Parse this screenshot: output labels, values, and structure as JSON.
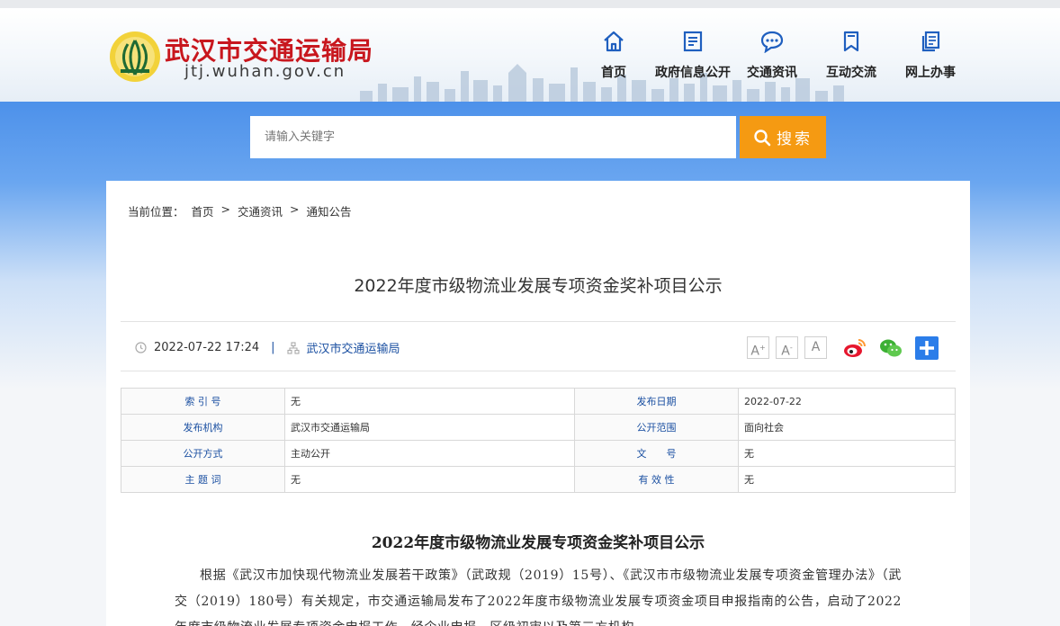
{
  "site": {
    "name": "武汉市交通运输局",
    "url": "jtj.wuhan.gov.cn"
  },
  "nav": [
    {
      "label": "首页",
      "icon": "home-icon"
    },
    {
      "label": "政府信息公开",
      "icon": "document-list-icon"
    },
    {
      "label": "交通资讯",
      "icon": "chat-bubble-icon"
    },
    {
      "label": "互动交流",
      "icon": "bookmark-icon"
    },
    {
      "label": "网上办事",
      "icon": "copy-document-icon"
    }
  ],
  "search": {
    "placeholder": "请输入关键字",
    "button_label": "搜索"
  },
  "breadcrumb": {
    "prefix": "当前位置：",
    "items": [
      "首页",
      "交通资讯",
      "通知公告"
    ],
    "separator": ">"
  },
  "article": {
    "title": "2022年度市级物流业发展专项资金奖补项目公示",
    "date": "2022-07-22 17:24",
    "divider": "|",
    "source": "武汉市交通运输局",
    "font_sizes": [
      "A",
      "A",
      "A"
    ],
    "share": [
      "weibo-icon",
      "wechat-icon",
      "plus-share-icon"
    ],
    "body_title": "2022年度市级物流业发展专项资金奖补项目公示",
    "paragraph": "根据《武汉市加快现代物流业发展若干政策》（武政规（2019）15号）、《武汉市市级物流业发展专项资金管理办法》（武交（2019）180号）有关规定，市交通运输局发布了2022年度市级物流业发展专项资金项目申报指南的公告，启动了2022年度市级物流业发展专项资金申报工作。经企业申报、区级初审以及第三方机构"
  },
  "info_table": [
    {
      "k1": "索 引 号",
      "v1": "无",
      "k2": "发布日期",
      "v2": "2022-07-22"
    },
    {
      "k1": "发布机构",
      "v1": "武汉市交通运输局",
      "k2": "公开范围",
      "v2": "面向社会"
    },
    {
      "k1": "公开方式",
      "v1": "主动公开",
      "k2": "文　　号",
      "v2": "无"
    },
    {
      "k1": "主 题 词",
      "v1": "无",
      "k2": "有 效 性",
      "v2": "无"
    }
  ],
  "colors": {
    "brand_red": "#c8171e",
    "link_blue": "#1a4fa1",
    "search_orange": "#f59a12",
    "band_blue": "#4d91ea"
  }
}
